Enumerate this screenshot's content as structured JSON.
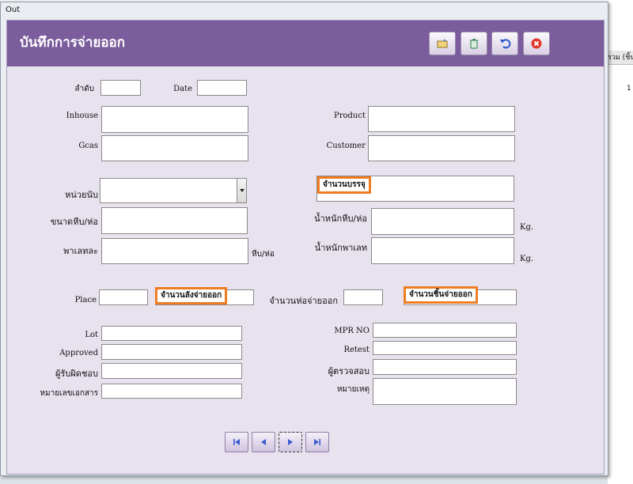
{
  "window": {
    "title": "Out"
  },
  "form": {
    "title": "บันทึกการจ่ายออก",
    "toolbar": [
      "new-record",
      "delete",
      "undo",
      "close"
    ]
  },
  "fields": {
    "seq": {
      "label": "ลำดับ",
      "value": ""
    },
    "date": {
      "label": "Date",
      "value": ""
    },
    "inhouse": {
      "label": "Inhouse",
      "value": ""
    },
    "gcas": {
      "label": "Gcas",
      "value": ""
    },
    "product": {
      "label": "Product",
      "value": ""
    },
    "customer": {
      "label": "Customer",
      "value": ""
    },
    "unit": {
      "label": "หน่วยนับ",
      "value": ""
    },
    "pack_qty": {
      "label": "จำนวนบรรจุ",
      "value": ""
    },
    "box_size": {
      "label": "ขนาดหีบ/ห่อ",
      "value": ""
    },
    "box_weight": {
      "label": "น้ำหนักหีบ/ห่อ",
      "value": "",
      "unit": "Kg."
    },
    "pallet": {
      "label": "พาเลทละ",
      "value": "",
      "unit": "หีบ/ห่อ"
    },
    "pallet_weight": {
      "label": "น้ำหนักพาเลท",
      "value": "",
      "unit": "Kg."
    },
    "place": {
      "label": "Place",
      "value": ""
    },
    "case_out": {
      "label": "จำนวนลังจ่ายออก",
      "value": ""
    },
    "pack_out": {
      "label": "จำนวนห่อจ่ายออก",
      "value": ""
    },
    "piece_out": {
      "label": "จำนวนชิ้นจ่ายออก",
      "value": ""
    },
    "lot": {
      "label": "Lot",
      "value": ""
    },
    "approved": {
      "label": "Approved",
      "value": ""
    },
    "responsible": {
      "label": "ผู้รับผิดชอบ",
      "value": ""
    },
    "doc_no": {
      "label": "หมายเลขเอกสาร",
      "value": ""
    },
    "mpr_no": {
      "label": "MPR NO",
      "value": ""
    },
    "retest": {
      "label": "Retest",
      "value": ""
    },
    "inspector": {
      "label": "ผู้ตรวจสอบ",
      "value": ""
    },
    "note": {
      "label": "หมายเหตุ",
      "value": ""
    }
  },
  "background": {
    "column_header": "รวม (ชิ้น)",
    "cell_value": "1"
  },
  "colors": {
    "header": "#7b5c9c",
    "form_bg": "#e8e2ee",
    "highlight": "#f07c22"
  }
}
